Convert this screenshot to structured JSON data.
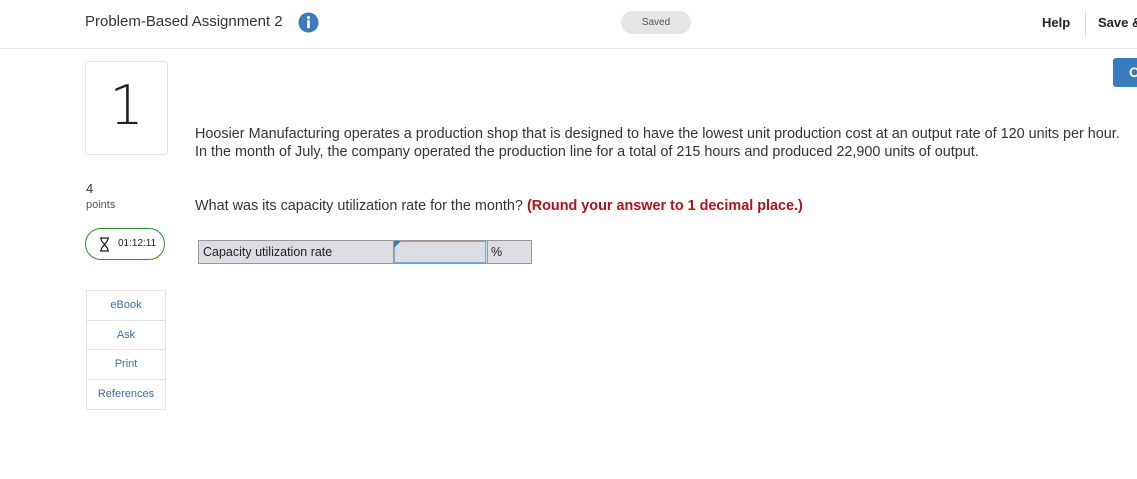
{
  "header": {
    "assignment_title": "Problem-Based Assignment 2",
    "info_icon": "info-circle-icon",
    "status": "Saved",
    "help_label": "Help",
    "save_exit_label": "Save &",
    "side_button_label": "C"
  },
  "question": {
    "number": "1",
    "points_value": "4",
    "points_label": "points",
    "body": "Hoosier Manufacturing operates a production shop that is designed to have the lowest unit production cost at an output rate of 120 units per hour. In the month of July, the company operated the production line for a total of 215 hours and produced 22,900 units of output.",
    "prompt": "What was its capacity utilization rate for the month?",
    "round_note": "(Round your answer to 1 decimal place.)"
  },
  "timer": {
    "icon": "hourglass-icon",
    "time": "01:12:11"
  },
  "tools": [
    {
      "label": "eBook"
    },
    {
      "label": "Ask"
    },
    {
      "label": "Print"
    },
    {
      "label": "References"
    }
  ],
  "answer": {
    "label": "Capacity utilization rate",
    "value": "",
    "unit": "%"
  },
  "colors": {
    "accent_blue": "#3a7bbd",
    "link_blue": "#3a6fa8",
    "timer_green": "#2e8b2e",
    "warning_red": "#b3111b",
    "table_gray": "#dcdde3"
  }
}
